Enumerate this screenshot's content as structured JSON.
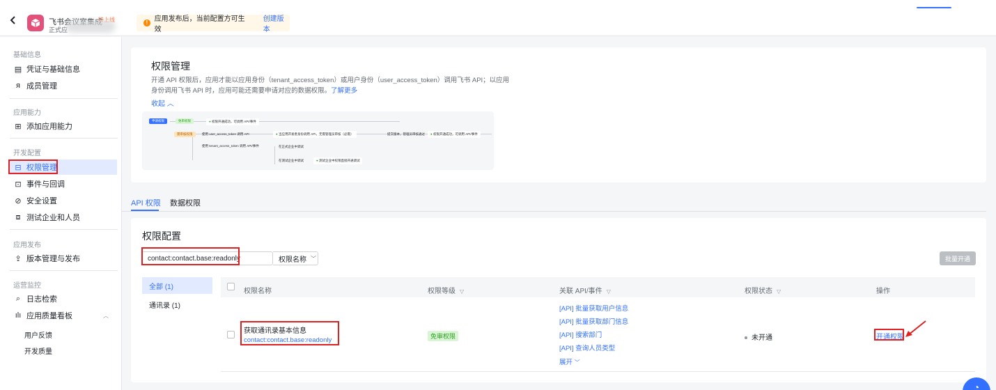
{
  "topbar": {
    "back_icon": "chevron-left-icon",
    "app_name": "飞书会议室集成",
    "app_badge": "待上线",
    "app_sub": "正式应",
    "notice_text": "应用发布后，当前配置方可生效",
    "notice_link": "创建版本"
  },
  "sidebar": {
    "sections": [
      {
        "title": "基础信息"
      },
      {
        "title": "应用能力"
      },
      {
        "title": "开发配置"
      },
      {
        "title": "应用发布"
      },
      {
        "title": "运营监控"
      }
    ],
    "items": [
      {
        "label": "凭证与基础信息",
        "icon": "credential-icon"
      },
      {
        "label": "成员管理",
        "icon": "member-icon"
      },
      {
        "label": "添加应用能力",
        "icon": "add-capability-icon"
      },
      {
        "label": "权限管理",
        "icon": "permission-icon"
      },
      {
        "label": "事件与回调",
        "icon": "event-icon"
      },
      {
        "label": "安全设置",
        "icon": "shield-icon"
      },
      {
        "label": "测试企业和人员",
        "icon": "test-icon"
      },
      {
        "label": "版本管理与发布",
        "icon": "upload-icon"
      },
      {
        "label": "日志检索",
        "icon": "log-icon"
      },
      {
        "label": "应用质量看板",
        "icon": "chart-icon"
      }
    ],
    "sub_items": [
      {
        "label": "用户反馈"
      },
      {
        "label": "开发质量"
      }
    ]
  },
  "intro": {
    "title": "权限管理",
    "desc": "开通 API 权限后，应用才能以应用身份（tenant_access_token）或用户身份（user_access_token）调用飞书 API；以应用身份调用飞书 API 时，应用可能还需要申请对应的数据权限。",
    "learn_more": "了解更多",
    "collapse": "收起",
    "flow": {
      "start": "申请权限",
      "free": "免审权限",
      "free_result": "权限开通成功，可调用 API/事件",
      "need": "需审核权限",
      "user_token": "使用 user_access_token 调用 API",
      "tenant_token": "使用 tenant_access_token 调用 API/事件",
      "in_scope": "当应用开发者身份调用 API，无需管理员审核（必需）",
      "publish": "提交版本，管理员审核通过",
      "result": "权限开通成功，可调用 API/事件",
      "ent_test": "在正式企业中调试",
      "test_ent": "在测试企业中调试",
      "test_result": "测试企业中权限直接开通调试"
    }
  },
  "tabs": [
    {
      "label": "API 权限",
      "active": true
    },
    {
      "label": "数据权限",
      "active": false
    }
  ],
  "config": {
    "title": "权限配置",
    "search_value": "contact:contact.base:readonly",
    "filter_label": "权限名称",
    "batch_label": "批量开通",
    "categories": [
      {
        "label": "全部 (1)",
        "active": true
      },
      {
        "label": "通讯录 (1)",
        "active": false
      }
    ],
    "columns": [
      {
        "label": "权限名称",
        "filter": false
      },
      {
        "label": "权限等级",
        "filter": true
      },
      {
        "label": "关联 API/事件",
        "filter": true
      },
      {
        "label": "权限状态",
        "filter": true
      },
      {
        "label": "操作",
        "filter": false
      }
    ],
    "rows": [
      {
        "name": "获取通讯录基本信息",
        "code": "contact:contact.base:readonly",
        "level": "免审权限",
        "apis": [
          "[API] 批量获取用户信息",
          "[API] 批量获取部门信息",
          "[API] 搜索部门",
          "[API] 查询人员类型"
        ],
        "expand": "展开",
        "status": "未开通",
        "action": "开通权限"
      }
    ]
  },
  "colors": {
    "accent": "#3370ff",
    "highlight": "#e02020",
    "success_bg": "#d9f5d6",
    "success_text": "#2ea121"
  }
}
